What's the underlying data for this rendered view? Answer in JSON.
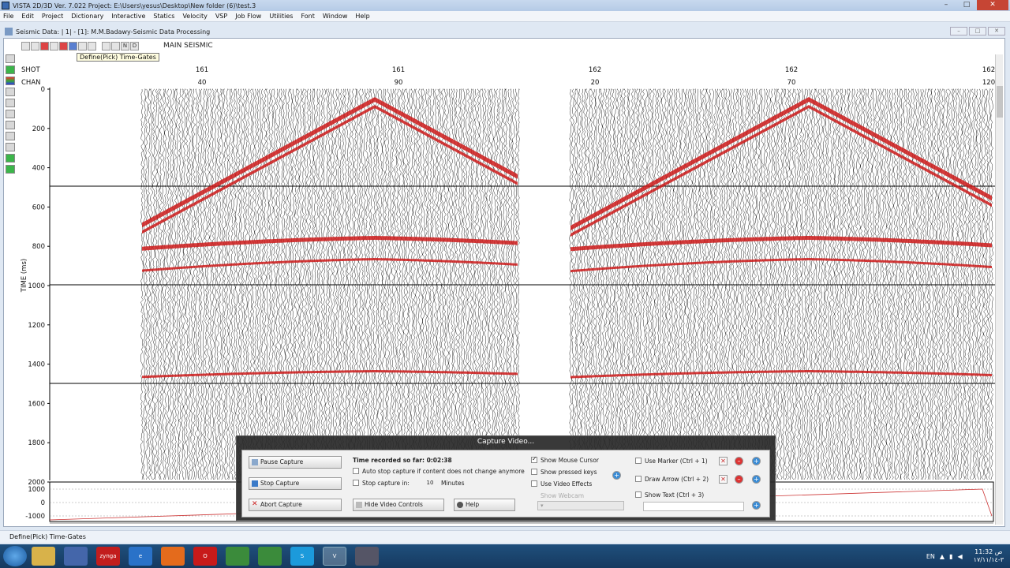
{
  "window": {
    "title": "VISTA 2D/3D Ver. 7.022 Project: E:\\Users\\yesus\\Desktop\\New folder (6)\\test.3",
    "buttons": {
      "minimize": "–",
      "maximize": "□",
      "close": "✕"
    }
  },
  "menu": [
    "File",
    "Edit",
    "Project",
    "Dictionary",
    "Interactive",
    "Statics",
    "Velocity",
    "VSP",
    "Job Flow",
    "Utilities",
    "Font",
    "Window",
    "Help"
  ],
  "child_window": {
    "title": "Seismic Data: | 1| - [1]: M.M.Badawy-Seismic Data Processing"
  },
  "toolbar": {
    "label": "MAIN SEISMIC",
    "tooltip": "Define(Pick) Time-Gates",
    "buttons": [
      "N",
      "D"
    ]
  },
  "axis": {
    "shot_label": "SHOT",
    "chan_label": "CHAN",
    "shot_ticks": [
      "161",
      "161",
      "162",
      "162",
      "162"
    ],
    "chan_ticks": [
      "40",
      "90",
      "20",
      "70",
      "120"
    ],
    "time_label": "TIME (ms)",
    "time_ticks": [
      "0",
      "200",
      "400",
      "600",
      "800",
      "1000",
      "1200",
      "1400",
      "1600",
      "1800",
      "2000"
    ],
    "lower_ticks": [
      "1000",
      "0",
      "-1000"
    ]
  },
  "status": {
    "text": "Define(Pick) Time-Gates"
  },
  "capture_dialog": {
    "title": "Capture Video...",
    "pause": "Pause Capture",
    "stop": "Stop Capture",
    "abort": "Abort Capture",
    "time_recorded": "Time recorded so far: 0:02:38",
    "auto_stop": "Auto stop capture if content does not change anymore",
    "stop_in": "Stop capture in:",
    "stop_in_value": "10",
    "minutes": "Minutes",
    "hide_controls": "Hide Video Controls",
    "help": "Help",
    "show_cursor": "Show Mouse Cursor",
    "show_keys": "Show pressed keys",
    "use_effects": "Use Video Effects",
    "show_webcam": "Show Webcam",
    "use_marker": "Use Marker (Ctrl + 1)",
    "draw_arrow": "Draw Arrow (Ctrl + 2)",
    "show_text": "Show Text (Ctrl + 3)"
  },
  "taskbar": {
    "apps": [
      "explorer",
      "media",
      "zynga",
      "ie",
      "firefox",
      "opera",
      "chrome",
      "chrome2",
      "skype",
      "vista",
      "capture"
    ],
    "zynga_label": "zynga",
    "lang": "EN",
    "time": "11:32 ص",
    "date": "٣-١٧/١١/١٤"
  },
  "colors": {
    "wiggle": "#111111",
    "fill": "#cc1a1a",
    "grid": "#000000"
  }
}
